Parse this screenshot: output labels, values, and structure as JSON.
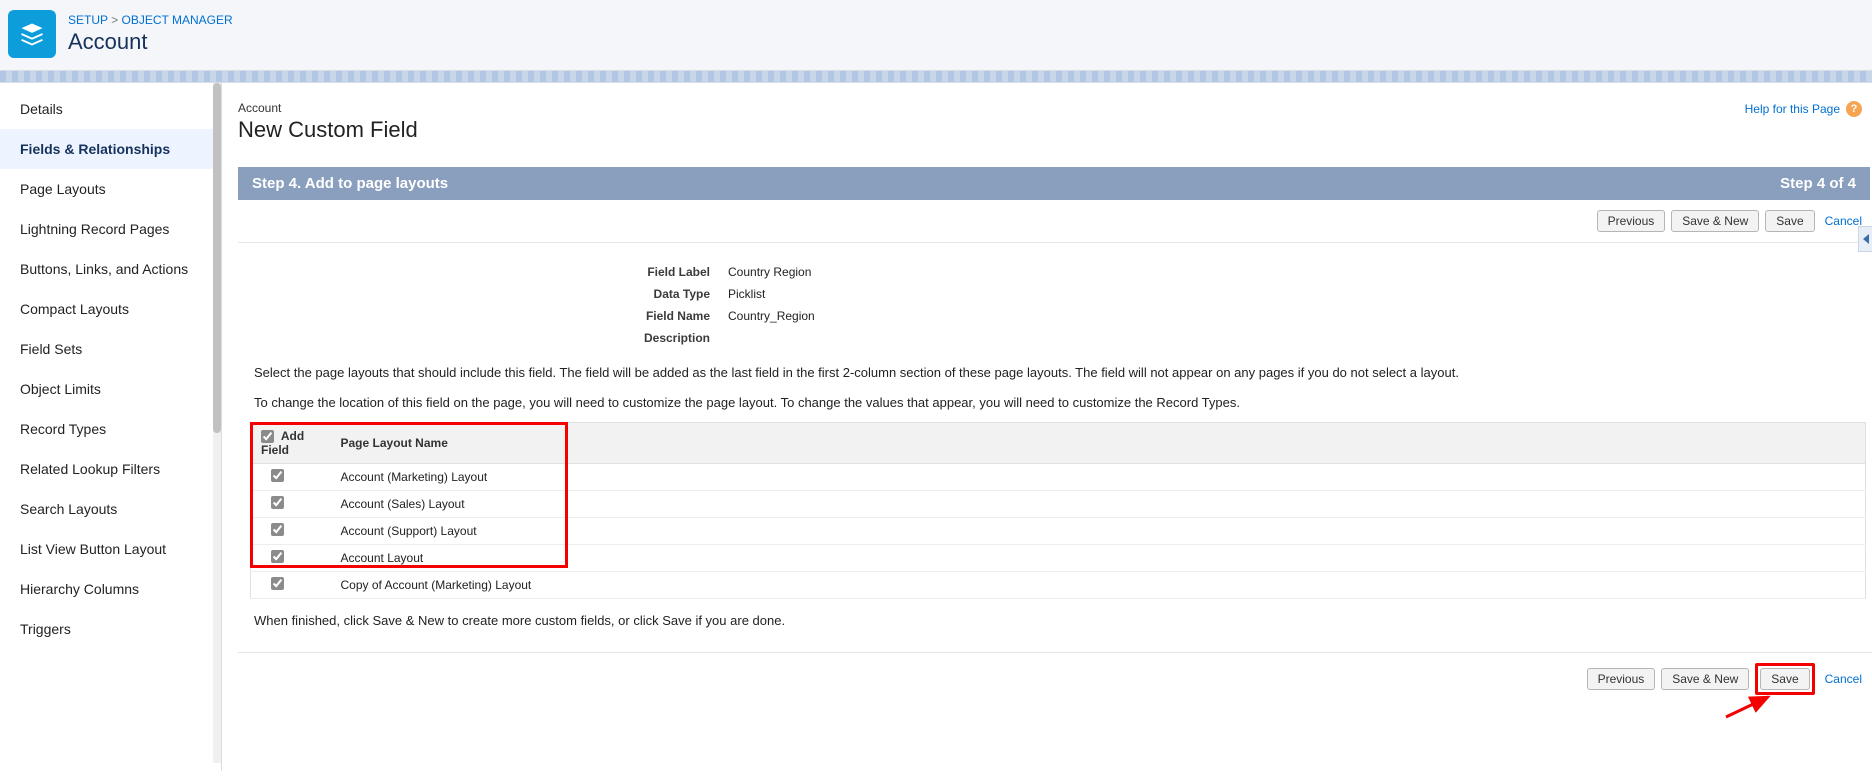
{
  "breadcrumb": {
    "setup": "SETUP",
    "sep": ">",
    "object_manager": "OBJECT MANAGER"
  },
  "header": {
    "title": "Account"
  },
  "sidebar": {
    "items": [
      {
        "label": "Details"
      },
      {
        "label": "Fields & Relationships"
      },
      {
        "label": "Page Layouts"
      },
      {
        "label": "Lightning Record Pages"
      },
      {
        "label": "Buttons, Links, and Actions"
      },
      {
        "label": "Compact Layouts"
      },
      {
        "label": "Field Sets"
      },
      {
        "label": "Object Limits"
      },
      {
        "label": "Record Types"
      },
      {
        "label": "Related Lookup Filters"
      },
      {
        "label": "Search Layouts"
      },
      {
        "label": "List View Button Layout"
      },
      {
        "label": "Hierarchy Columns"
      },
      {
        "label": "Triggers"
      }
    ],
    "active_index": 1
  },
  "page": {
    "eyebrow": "Account",
    "title": "New Custom Field",
    "help_label": "Help for this Page",
    "step_title": "Step 4. Add to page layouts",
    "step_indicator": "Step 4 of 4"
  },
  "buttons": {
    "previous": "Previous",
    "save_new": "Save & New",
    "save": "Save",
    "cancel": "Cancel"
  },
  "summary": {
    "field_label_label": "Field Label",
    "field_label_value": "Country Region",
    "data_type_label": "Data Type",
    "data_type_value": "Picklist",
    "field_name_label": "Field Name",
    "field_name_value": "Country_Region",
    "description_label": "Description",
    "description_value": ""
  },
  "instructions": {
    "line1": "Select the page layouts that should include this field. The field will be added as the last field in the first 2-column section of these page layouts. The field will not appear on any pages if you do not select a layout.",
    "line2": "To change the location of this field on the page, you will need to customize the page layout. To change the values that appear, you will need to customize the Record Types."
  },
  "table": {
    "col_add": "Add Field",
    "col_name": "Page Layout Name",
    "rows": [
      {
        "name": "Account (Marketing) Layout",
        "checked": true
      },
      {
        "name": "Account (Sales) Layout",
        "checked": true
      },
      {
        "name": "Account (Support) Layout",
        "checked": true
      },
      {
        "name": "Account Layout",
        "checked": true
      },
      {
        "name": "Copy of Account (Marketing) Layout",
        "checked": true
      }
    ]
  },
  "finish_text": "When finished, click Save & New to create more custom fields, or click Save if you are done."
}
